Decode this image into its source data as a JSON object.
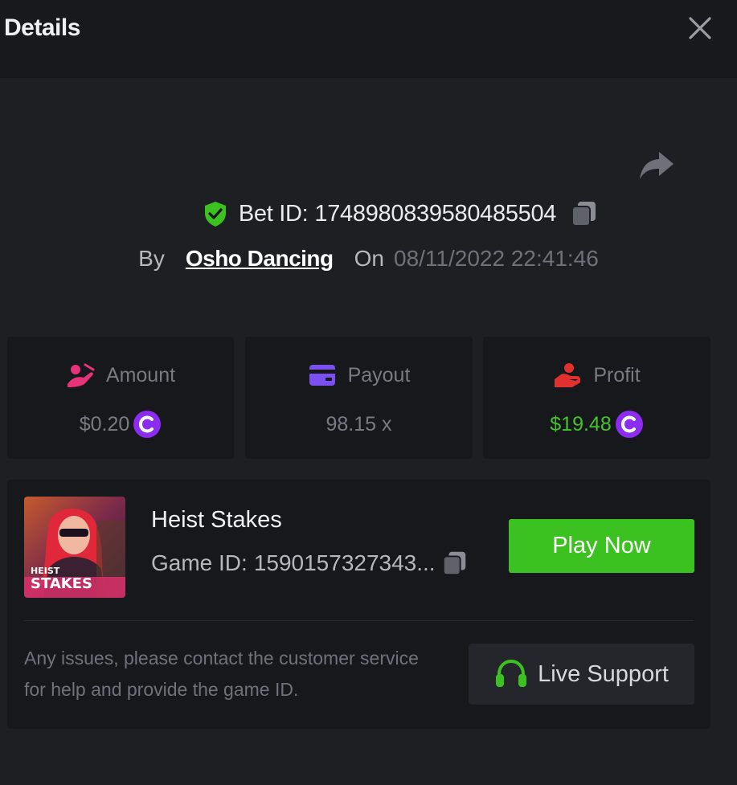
{
  "header": {
    "title": "Details",
    "close_icon": "close-icon"
  },
  "share_icon": "share-icon",
  "bet": {
    "verified_icon": "shield-check-icon",
    "id_label": "Bet ID:",
    "id_value": "1748980839580485504",
    "copy_icon": "copy-icon",
    "by_label": "By",
    "user": "Osho Dancing",
    "on_label": "On",
    "date": "08/11/2022 22:41:46"
  },
  "stats": {
    "amount": {
      "label": "Amount",
      "value": "$0.20",
      "icon": "bet-amount-icon",
      "currency_icon": "coin-icon",
      "color": "#e8337a"
    },
    "payout": {
      "label": "Payout",
      "value": "98.15 x",
      "icon": "wallet-card-icon",
      "color": "#7b4ff0"
    },
    "profit": {
      "label": "Profit",
      "value": "$19.48",
      "icon": "profit-hand-icon",
      "currency_icon": "coin-icon",
      "color": "#e0302f",
      "value_color": "#47c22d"
    }
  },
  "game": {
    "thumbnail_icon": "heist-stakes-thumbnail",
    "thumbnail_text_line1": "HEIST",
    "thumbnail_text_line2": "STAKES",
    "name": "Heist Stakes",
    "id_label": "Game ID:",
    "id_value": "1590157327343...",
    "copy_icon": "copy-icon",
    "play_label": "Play Now"
  },
  "support": {
    "help_text": "Any issues, please contact the customer service for help and provide the game ID.",
    "button_label": "Live Support",
    "icon": "headset-icon"
  },
  "colors": {
    "accent_green": "#3cc220",
    "background": "#1e1f23",
    "card": "#17181b",
    "coin_purple": "#8b2cf0"
  }
}
